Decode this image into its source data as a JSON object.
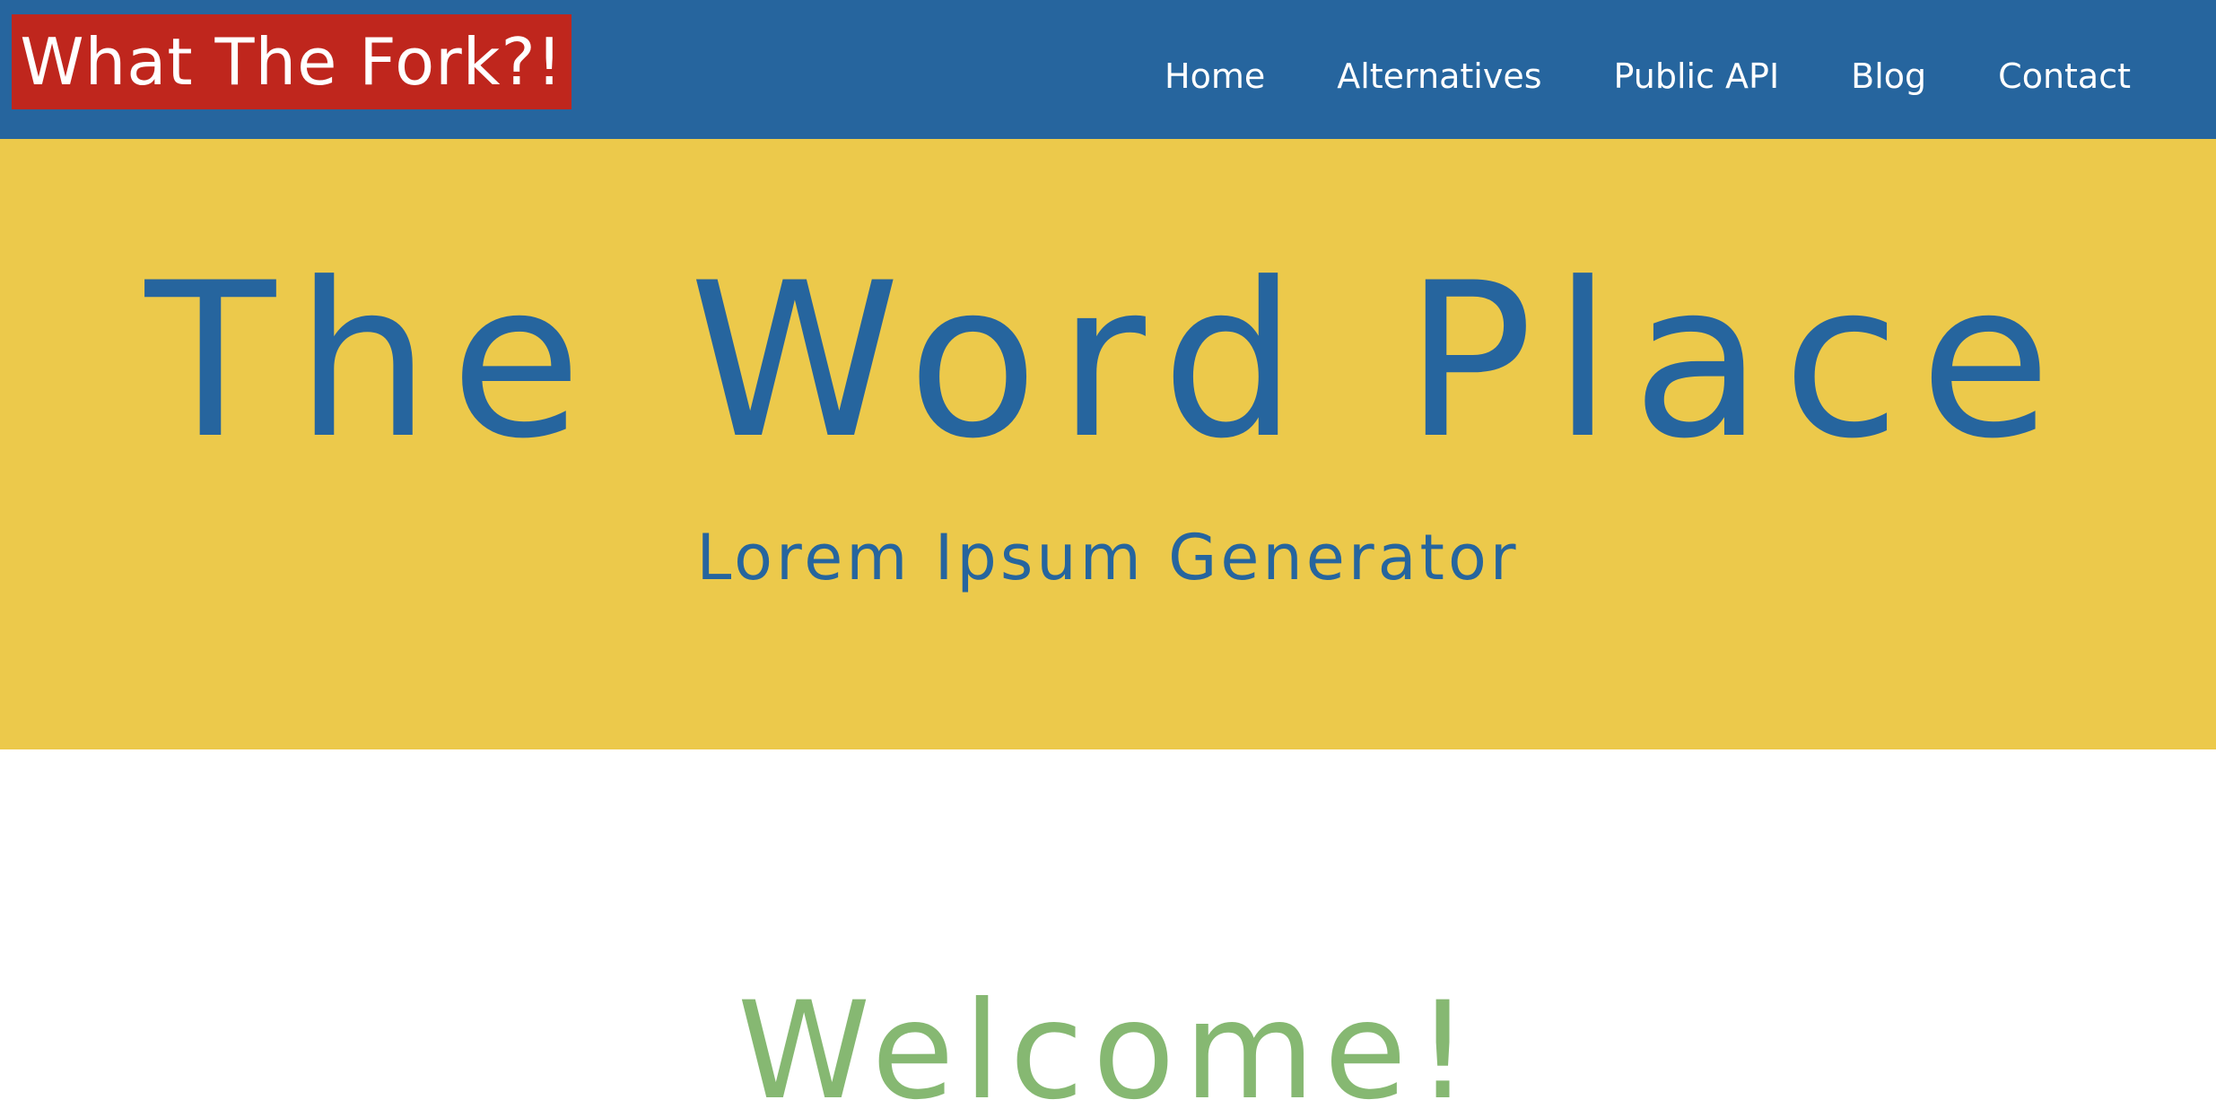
{
  "header": {
    "logo_text": "What The Fork?!",
    "nav": [
      {
        "label": "Home"
      },
      {
        "label": "Alternatives"
      },
      {
        "label": "Public API"
      },
      {
        "label": "Blog"
      },
      {
        "label": "Contact"
      }
    ]
  },
  "hero": {
    "title": "The Word Place",
    "subtitle": "Lorem Ipsum Generator"
  },
  "main": {
    "heading": "Welcome!"
  },
  "colors": {
    "header_bg": "#26659e",
    "logo_bg": "#bf261d",
    "hero_bg": "#ecc94b",
    "hero_text": "#26659e",
    "welcome_text": "#86b872"
  }
}
